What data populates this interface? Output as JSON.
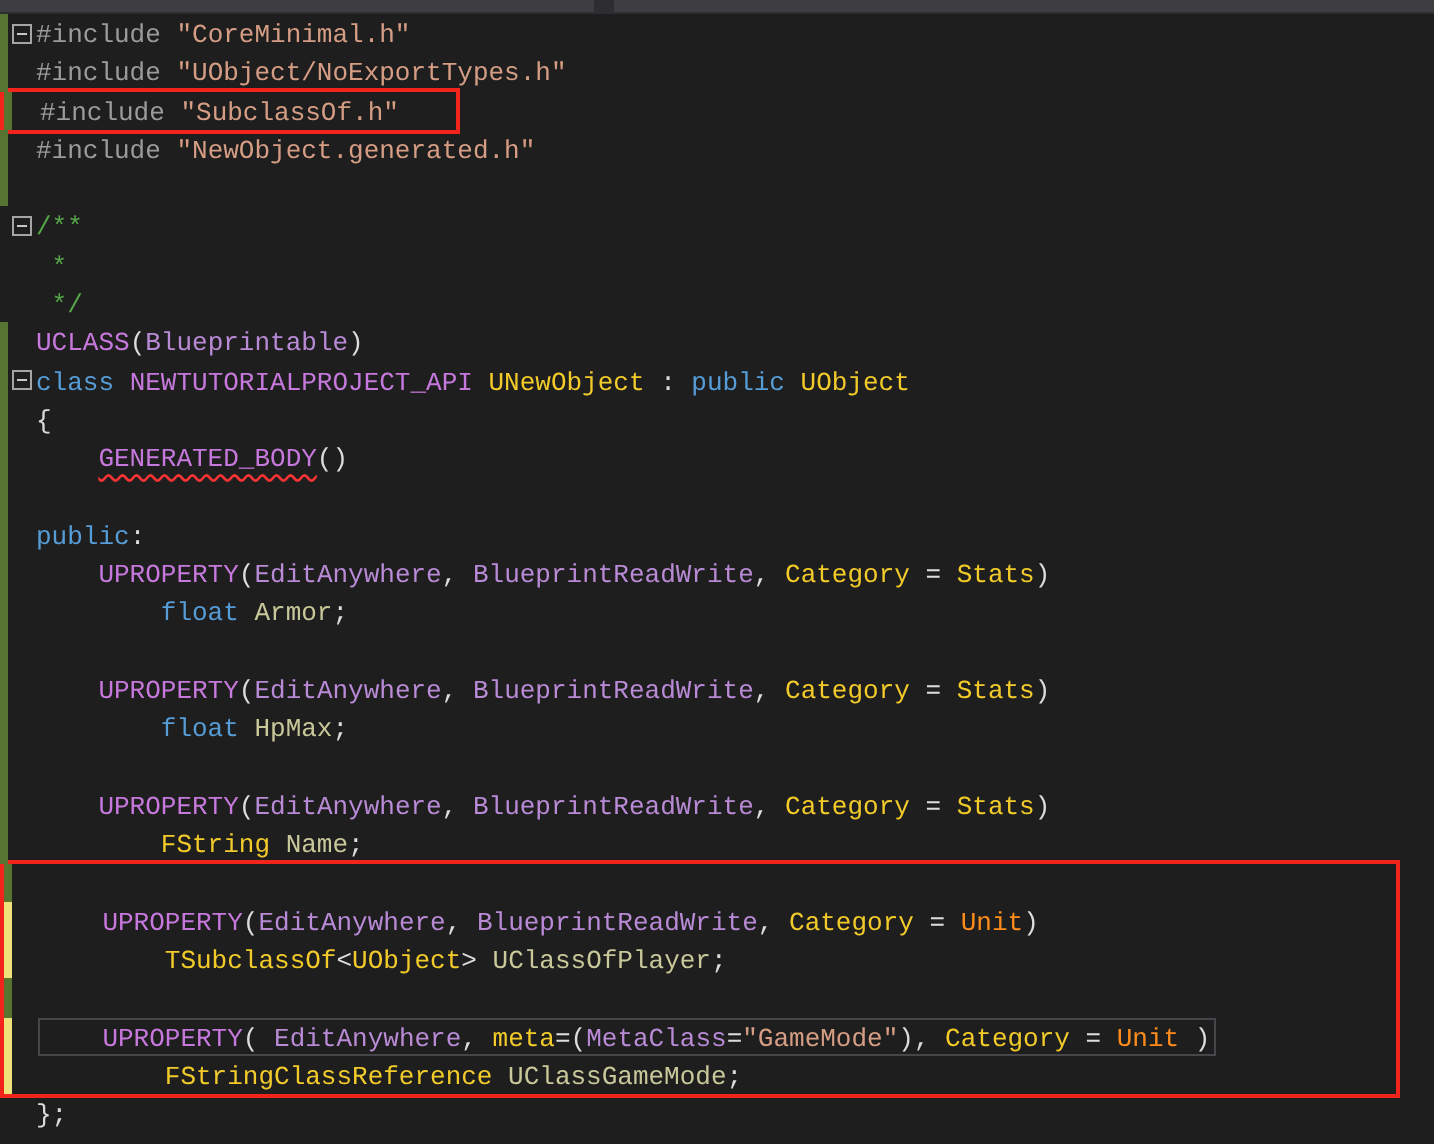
{
  "editor": {
    "lines": [
      {
        "changed": true,
        "saved": true,
        "fold": true,
        "tokens": [
          {
            "text": "#include ",
            "kind": "preproc"
          },
          {
            "text": "\"CoreMinimal.h\"",
            "kind": "string"
          }
        ]
      },
      {
        "changed": true,
        "saved": true,
        "tokens": [
          {
            "text": "#include ",
            "kind": "preproc"
          },
          {
            "text": "\"UObject/NoExportTypes.h\"",
            "kind": "string"
          }
        ]
      },
      {
        "changed": true,
        "saved": true,
        "highlighted": true,
        "tokens": [
          {
            "text": "#include ",
            "kind": "preproc"
          },
          {
            "text": "\"SubclassOf.h\"",
            "kind": "string"
          }
        ]
      },
      {
        "changed": true,
        "saved": true,
        "tokens": [
          {
            "text": "#include ",
            "kind": "preproc"
          },
          {
            "text": "\"NewObject.generated.h\"",
            "kind": "string"
          }
        ]
      },
      {
        "changed": true,
        "saved": true
      },
      {
        "fold": true,
        "tokens": [
          {
            "text": "/**",
            "kind": "comment"
          }
        ]
      },
      {
        "tokens": [
          {
            "text": " *",
            "kind": "comment"
          }
        ]
      },
      {
        "tokens": [
          {
            "text": " */",
            "kind": "comment"
          }
        ]
      },
      {
        "changed": true,
        "saved": true,
        "tokens": [
          {
            "text": "UCLASS",
            "kind": "macro"
          },
          {
            "text": "(",
            "kind": "plain"
          },
          {
            "text": "Blueprintable",
            "kind": "specifier"
          },
          {
            "text": ")",
            "kind": "plain"
          }
        ]
      },
      {
        "changed": true,
        "saved": true,
        "fold": true,
        "tokens": [
          {
            "text": "class ",
            "kind": "keyword"
          },
          {
            "text": "NEWTUTORIALPROJECT_API ",
            "kind": "macro"
          },
          {
            "text": "UNewObject",
            "kind": "type"
          },
          {
            "text": " : ",
            "kind": "plain"
          },
          {
            "text": "public ",
            "kind": "keyword"
          },
          {
            "text": "UObject",
            "kind": "type"
          }
        ]
      },
      {
        "changed": true,
        "saved": true,
        "tokens": [
          {
            "text": "{",
            "kind": "plain"
          }
        ],
        "children": [
          {
            "changed": true,
            "saved": true,
            "tokens": [
              {
                "text": "GENERATED_BODY",
                "kind": "macro",
                "error": true
              },
              {
                "text": "()",
                "kind": "plain"
              }
            ]
          },
          {
            "changed": true,
            "saved": true
          }
        ]
      },
      {
        "changed": true,
        "saved": true,
        "tokens": [
          {
            "text": "public",
            "kind": "keyword"
          },
          {
            "text": ":",
            "kind": "plain"
          }
        ],
        "children": [
          {
            "changed": true,
            "saved": true,
            "tokens": [
              {
                "text": "UPROPERTY",
                "kind": "macro"
              },
              {
                "text": "(",
                "kind": "plain"
              },
              {
                "text": "EditAnywhere",
                "kind": "specifier"
              },
              {
                "text": ", ",
                "kind": "plain"
              },
              {
                "text": "BlueprintReadWrite",
                "kind": "specifier"
              },
              {
                "text": ", ",
                "kind": "plain"
              },
              {
                "text": "Category",
                "kind": "type"
              },
              {
                "text": " = ",
                "kind": "plain"
              },
              {
                "text": "Stats",
                "kind": "type"
              },
              {
                "text": ")",
                "kind": "plain"
              }
            ],
            "children": [
              {
                "changed": true,
                "saved": true,
                "tokens": [
                  {
                    "text": "float ",
                    "kind": "keyword"
                  },
                  {
                    "text": "Armor",
                    "kind": "field"
                  },
                  {
                    "text": ";",
                    "kind": "plain"
                  }
                ]
              }
            ]
          },
          {
            "changed": true,
            "saved": true
          },
          {
            "changed": true,
            "saved": true,
            "tokens": [
              {
                "text": "UPROPERTY",
                "kind": "macro"
              },
              {
                "text": "(",
                "kind": "plain"
              },
              {
                "text": "EditAnywhere",
                "kind": "specifier"
              },
              {
                "text": ", ",
                "kind": "plain"
              },
              {
                "text": "BlueprintReadWrite",
                "kind": "specifier"
              },
              {
                "text": ", ",
                "kind": "plain"
              },
              {
                "text": "Category",
                "kind": "type"
              },
              {
                "text": " = ",
                "kind": "plain"
              },
              {
                "text": "Stats",
                "kind": "type"
              },
              {
                "text": ")",
                "kind": "plain"
              }
            ],
            "children": [
              {
                "changed": true,
                "saved": true,
                "tokens": [
                  {
                    "text": "float ",
                    "kind": "keyword"
                  },
                  {
                    "text": "HpMax",
                    "kind": "field"
                  },
                  {
                    "text": ";",
                    "kind": "plain"
                  }
                ]
              }
            ]
          },
          {
            "changed": true,
            "saved": true
          },
          {
            "changed": true,
            "saved": true,
            "tokens": [
              {
                "text": "UPROPERTY",
                "kind": "macro"
              },
              {
                "text": "(",
                "kind": "plain"
              },
              {
                "text": "EditAnywhere",
                "kind": "specifier"
              },
              {
                "text": ", ",
                "kind": "plain"
              },
              {
                "text": "BlueprintReadWrite",
                "kind": "specifier"
              },
              {
                "text": ", ",
                "kind": "plain"
              },
              {
                "text": "Category",
                "kind": "type"
              },
              {
                "text": " = ",
                "kind": "plain"
              },
              {
                "text": "Stats",
                "kind": "type"
              },
              {
                "text": ")",
                "kind": "plain"
              }
            ],
            "children": [
              {
                "changed": true,
                "saved": true,
                "tokens": [
                  {
                    "text": "FString ",
                    "kind": "type"
                  },
                  {
                    "text": "Name",
                    "kind": "field"
                  },
                  {
                    "text": ";",
                    "kind": "plain"
                  }
                ]
              }
            ]
          },
          {
            "changed": true,
            "saved": true,
            "highlighted": true
          },
          {
            "changed": true,
            "saved": false,
            "highlighted": true,
            "tokens": [
              {
                "text": "UPROPERTY",
                "kind": "macro"
              },
              {
                "text": "(",
                "kind": "plain"
              },
              {
                "text": "EditAnywhere",
                "kind": "specifier"
              },
              {
                "text": ", ",
                "kind": "plain"
              },
              {
                "text": "BlueprintReadWrite",
                "kind": "specifier"
              },
              {
                "text": ", ",
                "kind": "plain"
              },
              {
                "text": "Category",
                "kind": "type"
              },
              {
                "text": " = ",
                "kind": "plain"
              },
              {
                "text": "Unit",
                "kind": "enum"
              },
              {
                "text": ")",
                "kind": "plain"
              }
            ],
            "children": [
              {
                "changed": true,
                "saved": false,
                "highlighted": true,
                "tokens": [
                  {
                    "text": "TSubclassOf",
                    "kind": "type"
                  },
                  {
                    "text": "<",
                    "kind": "plain"
                  },
                  {
                    "text": "UObject",
                    "kind": "type"
                  },
                  {
                    "text": "> ",
                    "kind": "plain"
                  },
                  {
                    "text": "UClassOfPlayer",
                    "kind": "field"
                  },
                  {
                    "text": ";",
                    "kind": "plain"
                  }
                ]
              }
            ]
          },
          {
            "changed": true,
            "saved": true,
            "highlighted": true
          },
          {
            "changed": true,
            "saved": false,
            "highlighted": true,
            "current": true,
            "tokens": [
              {
                "text": "UPROPERTY",
                "kind": "macro"
              },
              {
                "text": "( ",
                "kind": "plain"
              },
              {
                "text": "EditAnywhere",
                "kind": "specifier"
              },
              {
                "text": ", ",
                "kind": "plain"
              },
              {
                "text": "meta",
                "kind": "type"
              },
              {
                "text": "=(",
                "kind": "plain"
              },
              {
                "text": "MetaClass",
                "kind": "specifier"
              },
              {
                "text": "=",
                "kind": "plain"
              },
              {
                "text": "\"GameMode\"",
                "kind": "string"
              },
              {
                "text": "), ",
                "kind": "plain"
              },
              {
                "text": "Category",
                "kind": "type"
              },
              {
                "text": " = ",
                "kind": "plain"
              },
              {
                "text": "Unit",
                "kind": "enum"
              },
              {
                "text": " )",
                "kind": "plain"
              }
            ],
            "children": [
              {
                "changed": true,
                "saved": false,
                "highlighted": true,
                "tokens": [
                  {
                    "text": "FStringClassReference ",
                    "kind": "type"
                  },
                  {
                    "text": "UClassGameMode",
                    "kind": "field"
                  },
                  {
                    "text": ";",
                    "kind": "plain"
                  }
                ]
              }
            ]
          }
        ]
      },
      {
        "tokens": [
          {
            "text": "};",
            "kind": "plain"
          }
        ]
      }
    ]
  }
}
